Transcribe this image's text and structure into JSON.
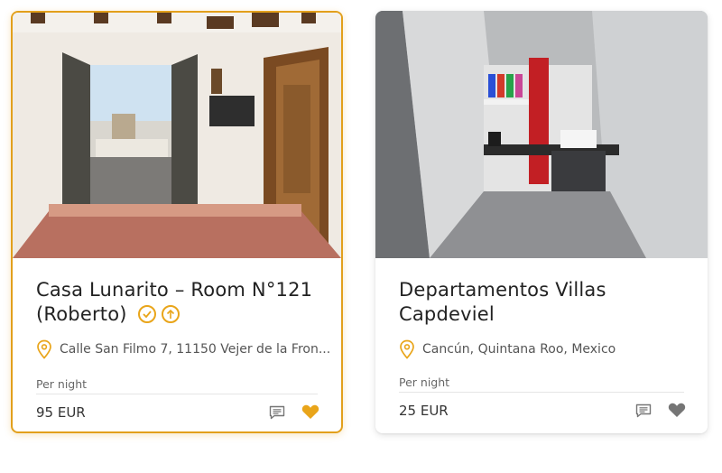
{
  "listings": [
    {
      "title_main": "Casa Lunarito – Room N°121",
      "title_sub": "(Roberto)",
      "location": "Calle San Filmo 7, 11150 Vejer de la Fron...",
      "per_night_label": "Per night",
      "price": "95 EUR",
      "selected": true,
      "favorite": true,
      "icons": [
        "verified-check-icon",
        "boost-arrow-icon",
        "location-pin-icon",
        "message-icon",
        "heart-icon"
      ]
    },
    {
      "title_main": "Departamentos Villas",
      "title_sub": "Capdeviel",
      "location": "Cancún, Quintana Roo, Mexico",
      "per_night_label": "Per night",
      "price": "25 EUR",
      "selected": false,
      "favorite": false,
      "icons": [
        "location-pin-icon",
        "message-icon",
        "heart-icon"
      ]
    }
  ],
  "colors": {
    "accent": "#e9a51a",
    "heart_inactive": "#757575",
    "text": "#222222",
    "muted": "#666666"
  }
}
